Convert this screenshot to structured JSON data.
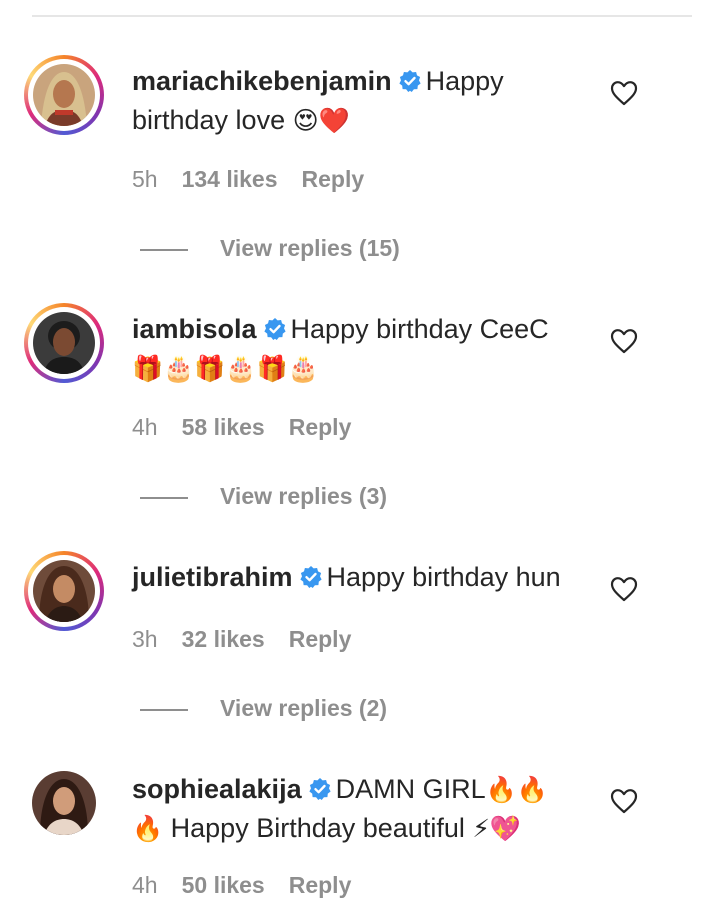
{
  "comments": [
    {
      "username": "mariachikebenjamin",
      "text_line1": "Happy",
      "text_line2": "birthday love",
      "emoji": "😍❤️",
      "time": "5h",
      "likes": "134 likes",
      "reply": "Reply",
      "view_replies": "View replies (15)"
    },
    {
      "username": "iambisola",
      "text_line1": "Happy birthday CeeC",
      "emoji": "🎁🎂🎁🎂🎁🎂",
      "time": "4h",
      "likes": "58 likes",
      "reply": "Reply",
      "view_replies": "View replies (3)"
    },
    {
      "username": "julietibrahim",
      "text_line1": "Happy birthday hun",
      "time": "3h",
      "likes": "32 likes",
      "reply": "Reply",
      "view_replies": "View replies (2)"
    },
    {
      "username": "sophiealakija",
      "text_line1": "DAMN GIRL",
      "emoji_line1": "🔥🔥",
      "emoji_line2_start": "🔥",
      "text_line2": "Happy Birthday beautiful",
      "emoji_line2_end": "⚡💖",
      "time": "4h",
      "likes": "50 likes",
      "reply": "Reply"
    }
  ],
  "icons": {
    "verified": "verified-badge-icon",
    "like": "heart-outline-icon"
  },
  "colors": {
    "verified": "#3897f0",
    "muted": "#8e8e8e",
    "text": "#262626"
  }
}
